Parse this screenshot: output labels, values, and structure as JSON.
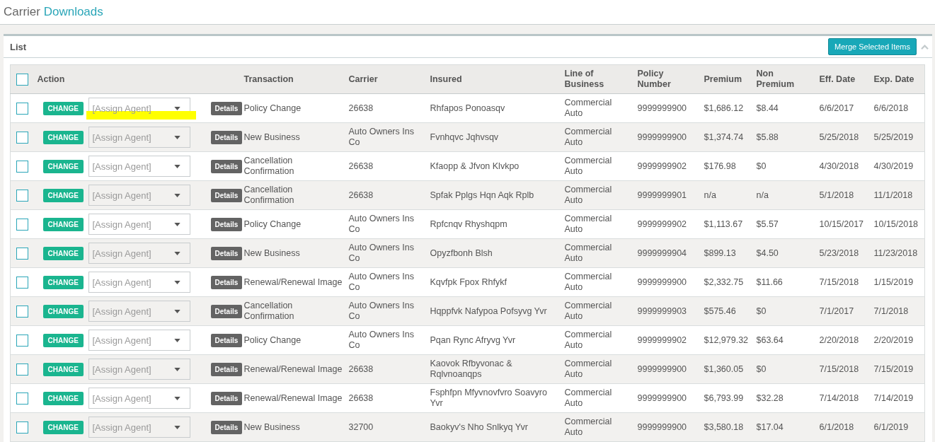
{
  "page_title": {
    "prefix": "Carrier",
    "suffix": "Downloads"
  },
  "panel": {
    "title": "List",
    "merge_button": "Merge Selected Items",
    "expanded": true
  },
  "table": {
    "select_all_checked": false,
    "columns": [
      "Action",
      "Transaction",
      "Carrier",
      "Insured",
      "Line of Business",
      "Policy Number",
      "Premium",
      "Non Premium",
      "Eff. Date",
      "Exp. Date"
    ],
    "rows": [
      {
        "checked": false,
        "action": "CHANGE",
        "agent_placeholder": "[Assign Agent]",
        "agent_highlighted": true,
        "details": "Details",
        "transaction": "Policy Change",
        "carrier": "26638",
        "insured": "Rhfapos Ponoasqv",
        "line_of_business": "Commercial Auto",
        "policy_number": "9999999900",
        "premium": "$1,686.12",
        "non_premium": "$8.44",
        "eff_date": "6/6/2017",
        "exp_date": "6/6/2018"
      },
      {
        "checked": false,
        "action": "CHANGE",
        "agent_placeholder": "[Assign Agent]",
        "agent_highlighted": false,
        "details": "Details",
        "transaction": "New Business",
        "carrier": "Auto Owners Ins Co",
        "insured": "Fvnhqvc Jqhvsqv",
        "line_of_business": "Commercial Auto",
        "policy_number": "9999999900",
        "premium": "$1,374.74",
        "non_premium": "$5.88",
        "eff_date": "5/25/2018",
        "exp_date": "5/25/2019"
      },
      {
        "checked": false,
        "action": "CHANGE",
        "agent_placeholder": "[Assign Agent]",
        "agent_highlighted": false,
        "details": "Details",
        "transaction": "Cancellation Confirmation",
        "carrier": "26638",
        "insured": "Kfaopp & Jfvon Klvkpo",
        "line_of_business": "Commercial Auto",
        "policy_number": "9999999902",
        "premium": "$176.98",
        "non_premium": "$0",
        "eff_date": "4/30/2018",
        "exp_date": "4/30/2019"
      },
      {
        "checked": false,
        "action": "CHANGE",
        "agent_placeholder": "[Assign Agent]",
        "agent_highlighted": false,
        "details": "Details",
        "transaction": "Cancellation Confirmation",
        "carrier": "26638",
        "insured": "Spfak Pplgs Hqn Aqk Rplb",
        "line_of_business": "Commercial Auto",
        "policy_number": "9999999901",
        "premium": "n/a",
        "non_premium": "n/a",
        "eff_date": "5/1/2018",
        "exp_date": "11/1/2018"
      },
      {
        "checked": false,
        "action": "CHANGE",
        "agent_placeholder": "[Assign Agent]",
        "agent_highlighted": false,
        "details": "Details",
        "transaction": "Policy Change",
        "carrier": "Auto Owners Ins Co",
        "insured": "Rpfcnqv Rhyshqpm",
        "line_of_business": "Commercial Auto",
        "policy_number": "9999999902",
        "premium": "$1,113.67",
        "non_premium": "$5.57",
        "eff_date": "10/15/2017",
        "exp_date": "10/15/2018"
      },
      {
        "checked": false,
        "action": "CHANGE",
        "agent_placeholder": "[Assign Agent]",
        "agent_highlighted": false,
        "details": "Details",
        "transaction": "New Business",
        "carrier": "Auto Owners Ins Co",
        "insured": "Opyzfbonh Blsh",
        "line_of_business": "Commercial Auto",
        "policy_number": "9999999904",
        "premium": "$899.13",
        "non_premium": "$4.50",
        "eff_date": "5/23/2018",
        "exp_date": "11/23/2018"
      },
      {
        "checked": false,
        "action": "CHANGE",
        "agent_placeholder": "[Assign Agent]",
        "agent_highlighted": false,
        "details": "Details",
        "transaction": "Renewal/Renewal Image",
        "carrier": "Auto Owners Ins Co",
        "insured": "Kqvfpk Fpox Rhfykf",
        "line_of_business": "Commercial Auto",
        "policy_number": "9999999900",
        "premium": "$2,332.75",
        "non_premium": "$11.66",
        "eff_date": "7/15/2018",
        "exp_date": "1/15/2019"
      },
      {
        "checked": false,
        "action": "CHANGE",
        "agent_placeholder": "[Assign Agent]",
        "agent_highlighted": false,
        "details": "Details",
        "transaction": "Cancellation Confirmation",
        "carrier": "Auto Owners Ins Co",
        "insured": "Hqppfvk Nafypoa Pofsyvg Yvr",
        "line_of_business": "Commercial Auto",
        "policy_number": "9999999903",
        "premium": "$575.46",
        "non_premium": "$0",
        "eff_date": "7/1/2017",
        "exp_date": "7/1/2018"
      },
      {
        "checked": false,
        "action": "CHANGE",
        "agent_placeholder": "[Assign Agent]",
        "agent_highlighted": false,
        "details": "Details",
        "transaction": "Policy Change",
        "carrier": "Auto Owners Ins Co",
        "insured": "Pqan Rync Afryvg Yvr",
        "line_of_business": "Commercial Auto",
        "policy_number": "9999999902",
        "premium": "$12,979.32",
        "non_premium": "$63.64",
        "eff_date": "2/20/2018",
        "exp_date": "2/20/2019"
      },
      {
        "checked": false,
        "action": "CHANGE",
        "agent_placeholder": "[Assign Agent]",
        "agent_highlighted": false,
        "details": "Details",
        "transaction": "Renewal/Renewal Image",
        "carrier": "26638",
        "insured": "Kaovok Rfbyvonac & Rqlvnoanqps",
        "line_of_business": "Commercial Auto",
        "policy_number": "9999999900",
        "premium": "$1,360.05",
        "non_premium": "$0",
        "eff_date": "7/15/2018",
        "exp_date": "7/15/2019"
      },
      {
        "checked": false,
        "action": "CHANGE",
        "agent_placeholder": "[Assign Agent]",
        "agent_highlighted": false,
        "details": "Details",
        "transaction": "Renewal/Renewal Image",
        "carrier": "26638",
        "insured": "Fsphfpn Mfyvnovfvro Soavyro Yvr",
        "line_of_business": "Commercial Auto",
        "policy_number": "9999999900",
        "premium": "$6,793.99",
        "non_premium": "$32.28",
        "eff_date": "7/14/2018",
        "exp_date": "7/14/2019"
      },
      {
        "checked": false,
        "action": "CHANGE",
        "agent_placeholder": "[Assign Agent]",
        "agent_highlighted": false,
        "details": "Details",
        "transaction": "New Business",
        "carrier": "32700",
        "insured": "Baokyv's Nho Snlkyq Yvr",
        "line_of_business": "Commercial Auto",
        "policy_number": "9999999900",
        "premium": "$3,580.18",
        "non_premium": "$17.04",
        "eff_date": "6/1/2018",
        "exp_date": "6/1/2019"
      }
    ]
  }
}
